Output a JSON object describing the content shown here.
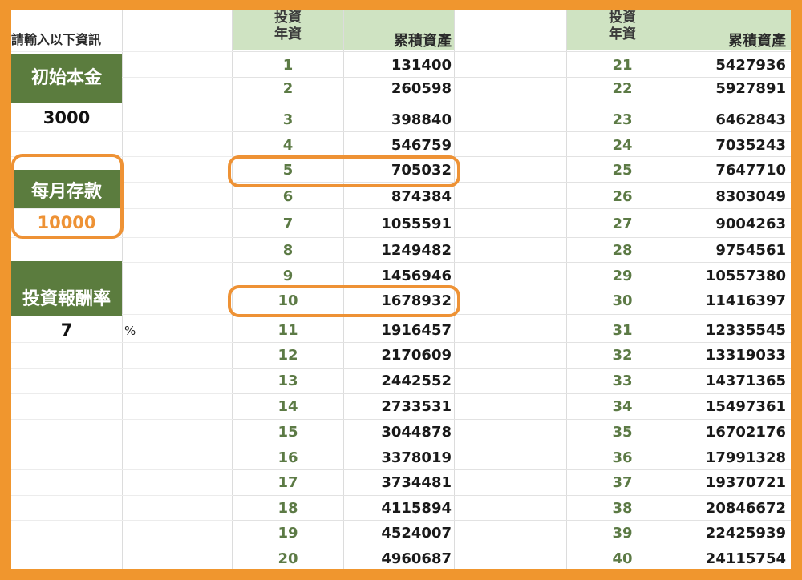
{
  "inputs": {
    "prompt": "請輸入以下資訊",
    "principal_label": "初始本金",
    "principal_value": "3000",
    "monthly_label": "每月存款",
    "monthly_value": "10000",
    "rate_label": "投資報酬率",
    "rate_value": "7",
    "rate_unit": "%"
  },
  "table": {
    "year_header_line1": "投資",
    "year_header_line2": "年資",
    "accum_header": "累積資產",
    "left": [
      {
        "year": "1",
        "value": "131400"
      },
      {
        "year": "2",
        "value": "260598"
      },
      {
        "year": "3",
        "value": "398840"
      },
      {
        "year": "4",
        "value": "546759"
      },
      {
        "year": "5",
        "value": "705032"
      },
      {
        "year": "6",
        "value": "874384"
      },
      {
        "year": "7",
        "value": "1055591"
      },
      {
        "year": "8",
        "value": "1249482"
      },
      {
        "year": "9",
        "value": "1456946"
      },
      {
        "year": "10",
        "value": "1678932"
      },
      {
        "year": "11",
        "value": "1916457"
      },
      {
        "year": "12",
        "value": "2170609"
      },
      {
        "year": "13",
        "value": "2442552"
      },
      {
        "year": "14",
        "value": "2733531"
      },
      {
        "year": "15",
        "value": "3044878"
      },
      {
        "year": "16",
        "value": "3378019"
      },
      {
        "year": "17",
        "value": "3734481"
      },
      {
        "year": "18",
        "value": "4115894"
      },
      {
        "year": "19",
        "value": "4524007"
      },
      {
        "year": "20",
        "value": "4960687"
      }
    ],
    "right": [
      {
        "year": "21",
        "value": "5427936"
      },
      {
        "year": "22",
        "value": "5927891"
      },
      {
        "year": "23",
        "value": "6462843"
      },
      {
        "year": "24",
        "value": "7035243"
      },
      {
        "year": "25",
        "value": "7647710"
      },
      {
        "year": "26",
        "value": "8303049"
      },
      {
        "year": "27",
        "value": "9004263"
      },
      {
        "year": "28",
        "value": "9754561"
      },
      {
        "year": "29",
        "value": "10557380"
      },
      {
        "year": "30",
        "value": "11416397"
      },
      {
        "year": "31",
        "value": "12335545"
      },
      {
        "year": "32",
        "value": "13319033"
      },
      {
        "year": "33",
        "value": "14371365"
      },
      {
        "year": "34",
        "value": "15497361"
      },
      {
        "year": "35",
        "value": "16702176"
      },
      {
        "year": "36",
        "value": "17991328"
      },
      {
        "year": "37",
        "value": "19370721"
      },
      {
        "year": "38",
        "value": "20846672"
      },
      {
        "year": "39",
        "value": "22425939"
      },
      {
        "year": "40",
        "value": "24115754"
      }
    ]
  },
  "colors": {
    "frame": "#f0962e",
    "header_bg": "#cfe3c2",
    "label_bg": "#5b7c3e",
    "year_text": "#5c7a45",
    "highlight": "#ee9235"
  }
}
